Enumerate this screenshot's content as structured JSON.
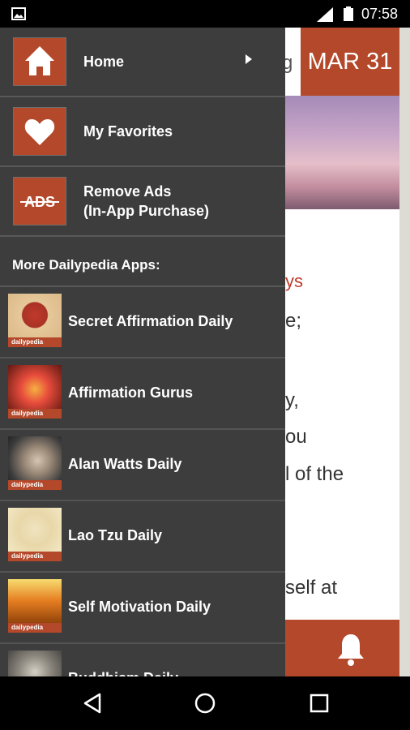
{
  "status_bar": {
    "time": "07:58"
  },
  "background": {
    "title_partial": "g",
    "date": "MAR 31",
    "text_lines": [
      "ys",
      "e;",
      "y,",
      "ou",
      "l of the",
      "self at"
    ]
  },
  "drawer": {
    "menu": [
      {
        "label": "Home",
        "icon": "home-icon"
      },
      {
        "label": "My Favorites",
        "icon": "heart-icon"
      },
      {
        "label_line1": "Remove Ads",
        "label_line2": "(In-App Purchase)",
        "icon": "no-ads-icon",
        "icon_text": "ADS"
      }
    ],
    "more_title": "More Dailypedia Apps:",
    "brand": "dailypedia",
    "apps": [
      {
        "name": "Secret Affirmation Daily"
      },
      {
        "name": "Affirmation Gurus"
      },
      {
        "name": "Alan Watts Daily"
      },
      {
        "name": "Lao Tzu Daily"
      },
      {
        "name": "Self Motivation Daily"
      },
      {
        "name": "Buddhism Daily"
      }
    ]
  },
  "colors": {
    "accent": "#b4482a",
    "drawer_bg": "#3d3d3d"
  }
}
